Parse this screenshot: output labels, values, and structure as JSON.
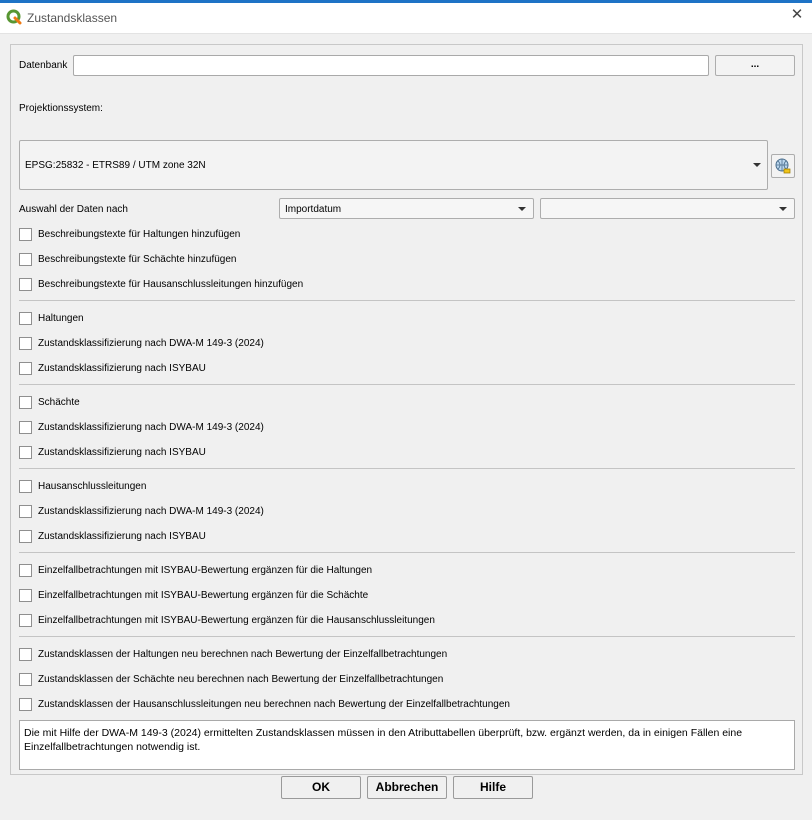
{
  "window": {
    "title": "Zustandsklassen",
    "close_glyph": "✕",
    "accent": "#1e73c6"
  },
  "datenbank": {
    "label": "Datenbank",
    "value": "",
    "browse_label": "..."
  },
  "projektion": {
    "label": "Projektionssystem:",
    "value": "EPSG:25832 - ETRS89 / UTM zone 32N",
    "picker_icon": "crs-globe-icon"
  },
  "auswahl": {
    "label": "Auswahl der Daten nach",
    "combo1": "Importdatum",
    "combo2": ""
  },
  "groups": [
    {
      "items": [
        "Beschreibungstexte für Haltungen hinzufügen",
        "Beschreibungstexte für Schächte hinzufügen",
        "Beschreibungstexte für Hausanschlussleitungen hinzufügen"
      ]
    },
    {
      "items": [
        "Haltungen",
        "Zustandsklassifizierung nach DWA-M 149-3 (2024)",
        "Zustandsklassifizierung nach ISYBAU"
      ]
    },
    {
      "items": [
        "Schächte",
        "Zustandsklassifizierung nach DWA-M 149-3 (2024)",
        "Zustandsklassifizierung nach ISYBAU"
      ]
    },
    {
      "items": [
        "Hausanschlussleitungen",
        "Zustandsklassifizierung nach DWA-M 149-3 (2024)",
        "Zustandsklassifizierung nach ISYBAU"
      ]
    },
    {
      "items": [
        "Einzelfallbetrachtungen mit ISYBAU-Bewertung ergänzen für die Haltungen",
        "Einzelfallbetrachtungen mit ISYBAU-Bewertung ergänzen für die Schächte",
        "Einzelfallbetrachtungen mit ISYBAU-Bewertung ergänzen für die Hausanschlussleitungen"
      ]
    },
    {
      "items": [
        "Zustandsklassen der Haltungen neu berechnen nach Bewertung der Einzelfallbetrachtungen",
        "Zustandsklassen der Schächte neu berechnen nach Bewertung der Einzelfallbetrachtungen",
        "Zustandsklassen der Hausanschlussleitungen neu berechnen nach Bewertung der Einzelfallbetrachtungen"
      ]
    }
  ],
  "note": "Die mit Hilfe der DWA-M 149-3 (2024) ermittelten Zustandsklassen müssen in den Atributtabellen überprüft, bzw. ergänzt werden, da in einigen Fällen eine Einzelfallbetrachtungen notwendig ist.",
  "buttons": {
    "ok": "OK",
    "cancel": "Abbrechen",
    "help": "Hilfe"
  }
}
